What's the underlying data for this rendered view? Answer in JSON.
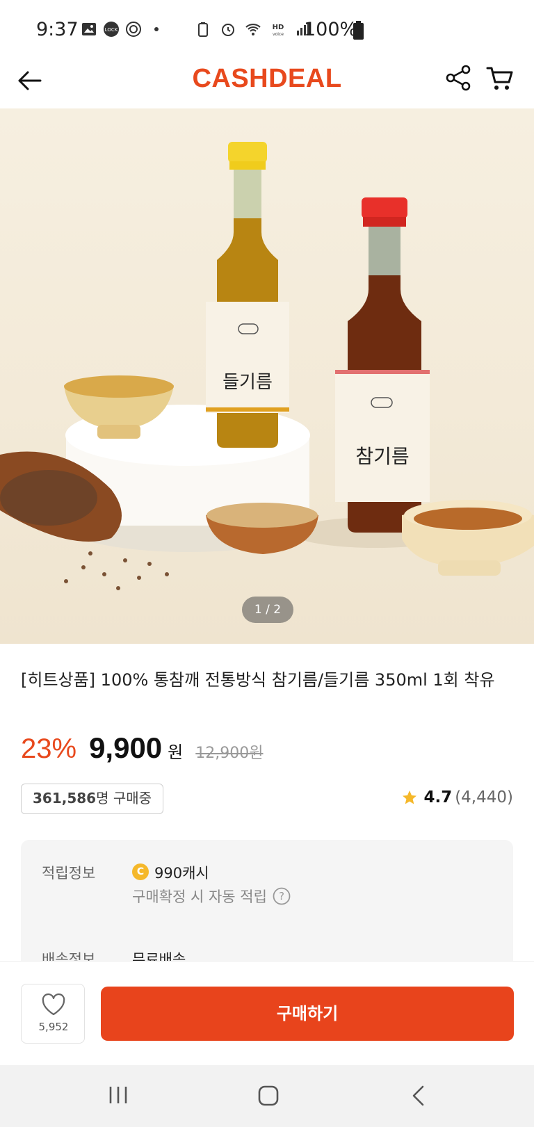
{
  "status_bar": {
    "time": "9:37",
    "battery": "100%",
    "icons": [
      "gallery-icon",
      "lock-icon",
      "settings-icon",
      "dot-icon",
      "battery-saver-icon",
      "alarm-icon",
      "wifi-icon",
      "hd-voice-icon",
      "signal-icon",
      "battery-icon"
    ]
  },
  "header": {
    "logo": "CASHDEAL",
    "icons": [
      "back-arrow-icon",
      "share-icon",
      "cart-icon"
    ]
  },
  "gallery": {
    "pager": "1 / 2",
    "product_labels": [
      "들기름",
      "참기름"
    ]
  },
  "product": {
    "title": "[히트상품] 100% 통참깨 전통방식 참기름/들기름 350ml 1회 착유",
    "discount": "23%",
    "price": "9,900",
    "currency": "원",
    "original_price": "12,900원",
    "buyers_count": "361,586",
    "buyers_suffix": "명 구매중",
    "rating": "4.7",
    "review_count": "(4,440)"
  },
  "info": {
    "reward_label": "적립정보",
    "reward_value": "990캐시",
    "reward_note": "구매확정 시 자동 적립",
    "shipping_label": "배송정보",
    "shipping_value": "무료배송",
    "coin_symbol": "C"
  },
  "actions": {
    "like_count": "5,952",
    "buy_label": "구매하기"
  },
  "colors": {
    "brand": "#e8491d",
    "buy_button": "#e8441c",
    "star": "#f5b82a"
  }
}
